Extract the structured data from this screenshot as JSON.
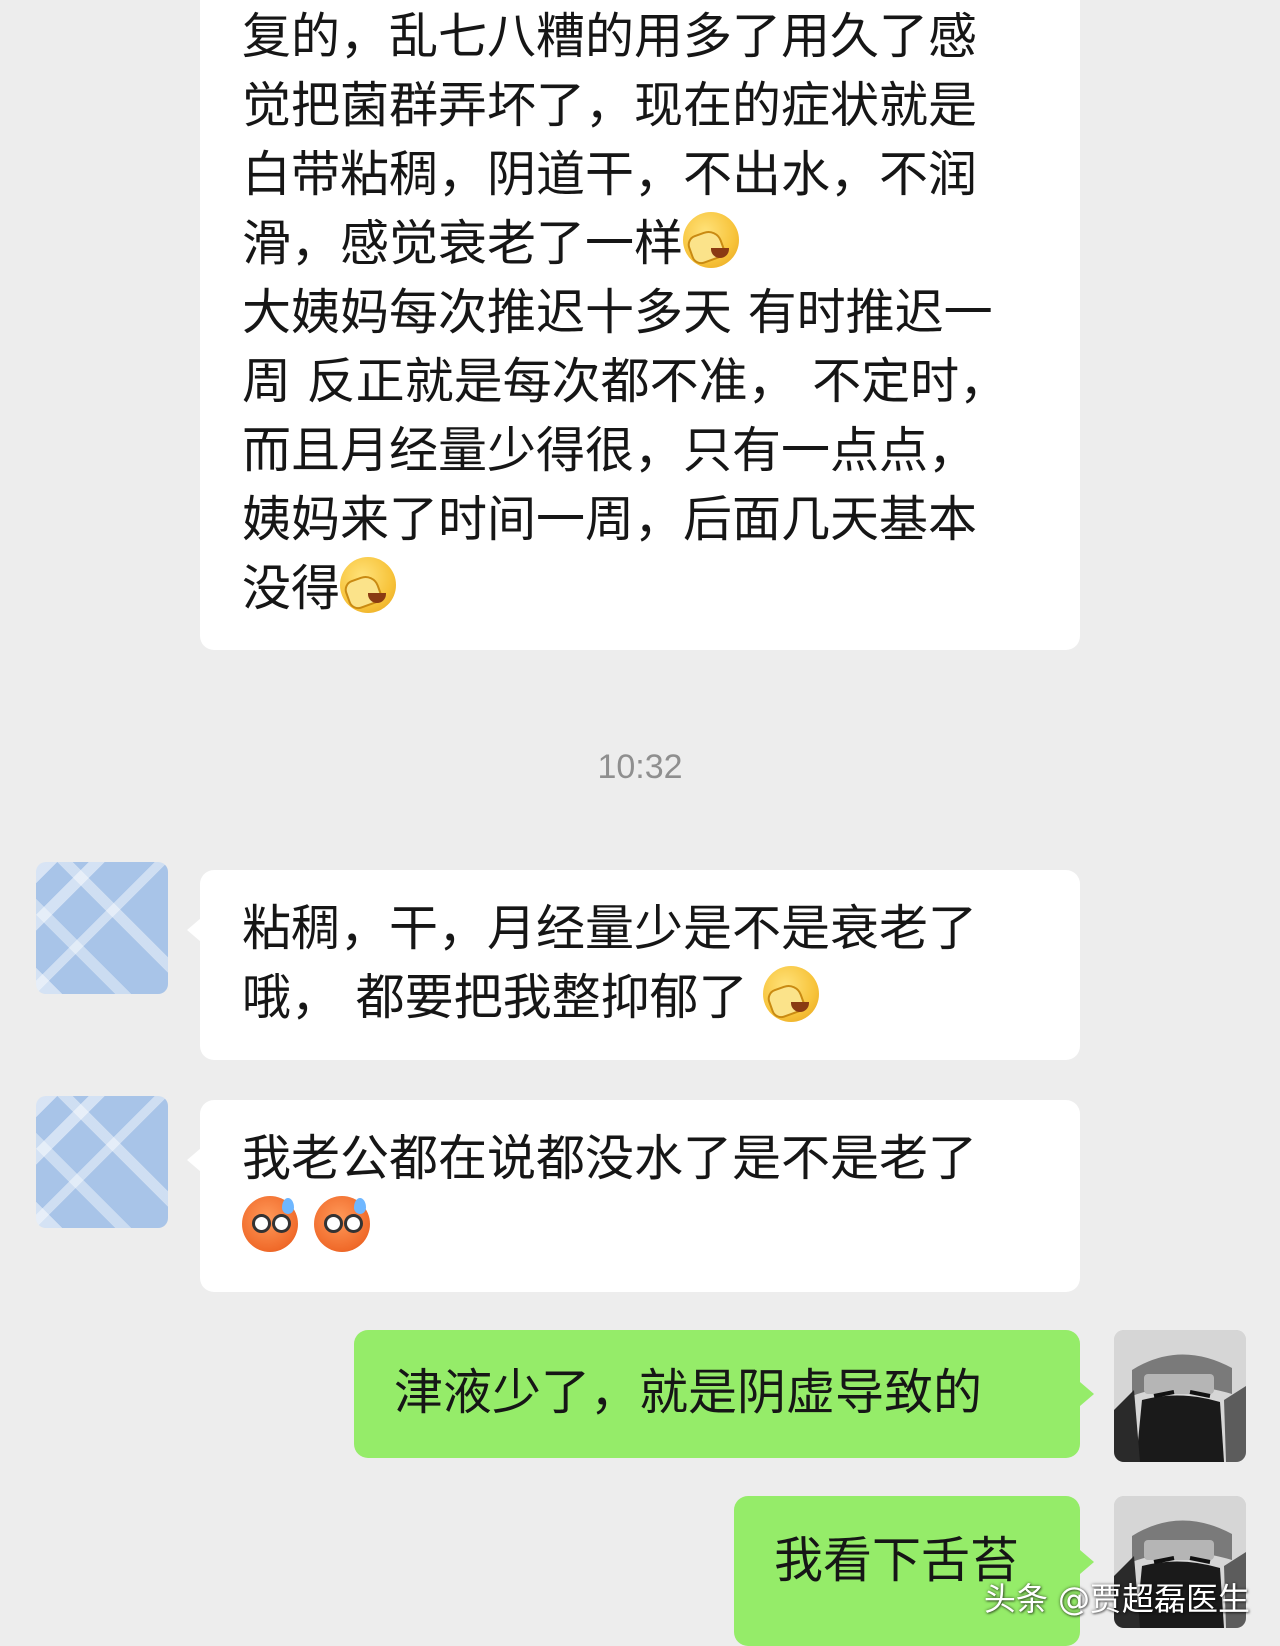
{
  "messages": [
    {
      "side": "incoming",
      "lines": [
        "复的，乱七八糟的用多了用久了感",
        "觉把菌群弄坏了，现在的症状就是",
        "白带粘稠，阴道干，不出水，不润",
        "滑，感觉衰老了一样",
        "大姨妈每次推迟十多天 有时推迟一",
        "周 反正就是每次都不准， 不定时，",
        "而且月经量少得很，只有一点点，",
        "姨妈来了时间一周，后面几天基本",
        "没得"
      ]
    },
    {
      "timestamp": "10:32"
    },
    {
      "side": "incoming",
      "lines": [
        "粘稠，干，月经量少是不是衰老了",
        "哦， 都要把我整抑郁了"
      ]
    },
    {
      "side": "incoming",
      "lines": [
        "我老公都在说都没水了是不是老了"
      ]
    },
    {
      "side": "outgoing",
      "lines": [
        "津液少了，就是阴虚导致的"
      ]
    },
    {
      "side": "outgoing",
      "lines": [
        "我看下舌苔"
      ]
    }
  ],
  "emojis": {
    "facepalm": "facepalm-emoji",
    "sweat": "sweat-face-emoji"
  },
  "watermark": "头条 @贾超磊医生",
  "colors": {
    "background": "#ededed",
    "incoming_bubble": "#ffffff",
    "outgoing_bubble": "#95ec69",
    "timestamp": "#8f8f8f"
  }
}
